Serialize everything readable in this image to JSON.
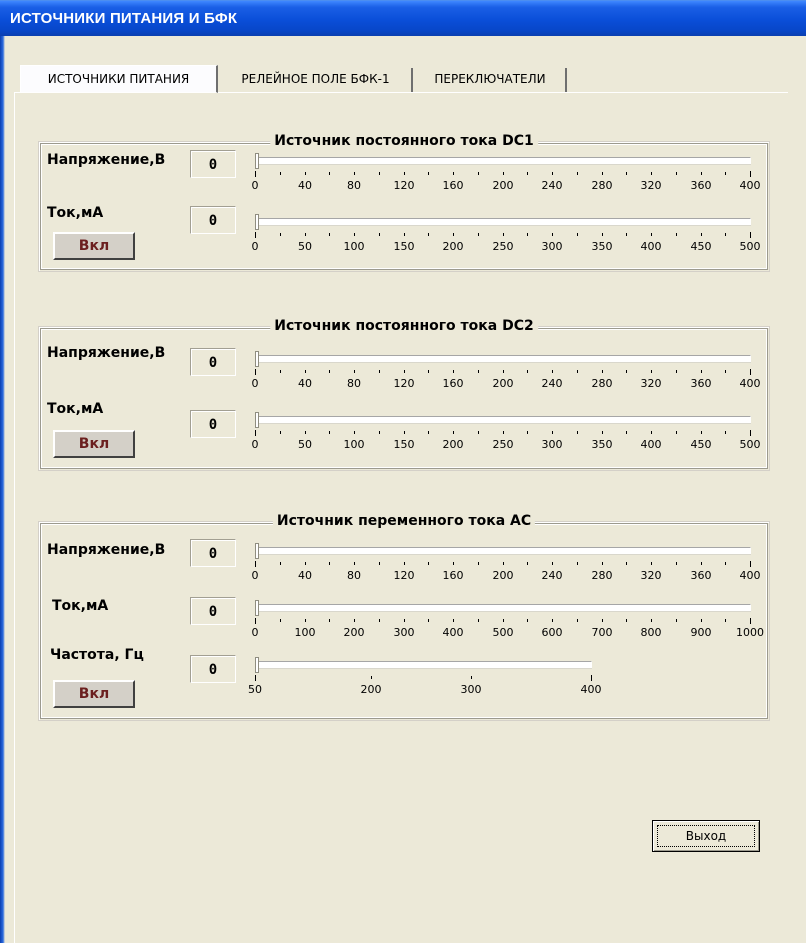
{
  "window": {
    "title": "ИСТОЧНИКИ ПИТАНИЯ И БФК"
  },
  "tabs": [
    {
      "label": "ИСТОЧНИКИ ПИТАНИЯ",
      "active": true
    },
    {
      "label": "РЕЛЕЙНОЕ ПОЛЕ БФК-1",
      "active": false
    },
    {
      "label": "ПЕРЕКЛЮЧАТЕЛИ",
      "active": false
    }
  ],
  "groups": [
    {
      "title": "Источник постоянного тока DC1",
      "voltage": {
        "label": "Напряжение,В",
        "value": "0",
        "slider_value": 0,
        "scale": [
          "0",
          "40",
          "80",
          "120",
          "160",
          "200",
          "240",
          "280",
          "320",
          "360",
          "400"
        ]
      },
      "current": {
        "label": "Ток,мА",
        "value": "0",
        "slider_value": 0,
        "scale": [
          "0",
          "50",
          "100",
          "150",
          "200",
          "250",
          "300",
          "350",
          "400",
          "450",
          "500"
        ]
      },
      "button": "Вкл"
    },
    {
      "title": "Источник постоянного тока DC2",
      "voltage": {
        "label": "Напряжение,В",
        "value": "0",
        "slider_value": 0,
        "scale": [
          "0",
          "40",
          "80",
          "120",
          "160",
          "200",
          "240",
          "280",
          "320",
          "360",
          "400"
        ]
      },
      "current": {
        "label": "Ток,мА",
        "value": "0",
        "slider_value": 0,
        "scale": [
          "0",
          "50",
          "100",
          "150",
          "200",
          "250",
          "300",
          "350",
          "400",
          "450",
          "500"
        ]
      },
      "button": "Вкл"
    },
    {
      "title": "Источник переменного тока АС",
      "voltage": {
        "label": "Напряжение,В",
        "value": "0",
        "slider_value": 0,
        "scale": [
          "0",
          "40",
          "80",
          "120",
          "160",
          "200",
          "240",
          "280",
          "320",
          "360",
          "400"
        ]
      },
      "current": {
        "label": "Ток,мА",
        "value": "0",
        "slider_value": 0,
        "scale": [
          "0",
          "100",
          "200",
          "300",
          "400",
          "500",
          "600",
          "700",
          "800",
          "900",
          "1000"
        ]
      },
      "frequency": {
        "label": "Частота, Гц",
        "value": "0",
        "slider_value": 50,
        "scale": [
          "50",
          "200",
          "300",
          "400"
        ]
      },
      "button": "Вкл"
    }
  ],
  "exit_button": "Выход",
  "colors": {
    "titlebar": "#0a4ed8",
    "background": "#ece9d8",
    "button_text": "#6b1f1f"
  }
}
